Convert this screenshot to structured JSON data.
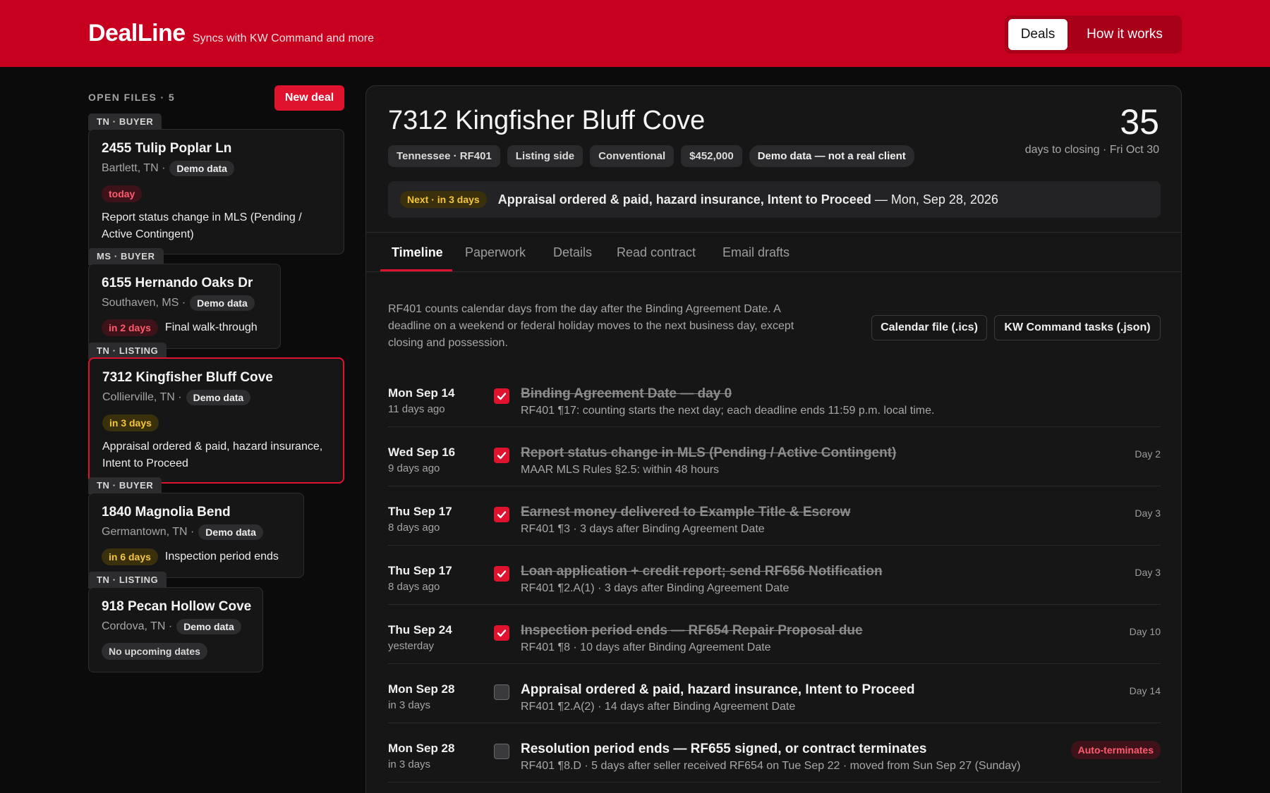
{
  "header": {
    "brand": "DealLine",
    "tagline": "Syncs with KW Command and more",
    "nav": {
      "deals": "Deals",
      "how": "How it works"
    },
    "brand_color": "#c8001f"
  },
  "sidebar": {
    "heading": "OPEN FILES · 5",
    "new_deal": "New deal",
    "cards": [
      {
        "tag": "TN · BUYER",
        "title": "2455 Tulip Poplar Ln",
        "loc": "Bartlett, TN ·",
        "demo": "Demo data",
        "pill": "today",
        "pill_color": "red",
        "task": "Report status change in MLS (Pending / Active Contingent)"
      },
      {
        "tag": "MS · BUYER",
        "title": "6155 Hernando Oaks Dr",
        "loc": "Southaven, MS ·",
        "demo": "Demo data",
        "pill": "in 2 days",
        "pill_color": "red",
        "task": "Final walk-through"
      },
      {
        "tag": "TN · LISTING",
        "title": "7312 Kingfisher Bluff Cove",
        "loc": "Collierville, TN ·",
        "demo": "Demo data",
        "pill": "in 3 days",
        "pill_color": "yellow",
        "task": "Appraisal ordered & paid, hazard insurance, Intent to Proceed"
      },
      {
        "tag": "TN · BUYER",
        "title": "1840 Magnolia Bend",
        "loc": "Germantown, TN ·",
        "demo": "Demo data",
        "pill": "in 6 days",
        "pill_color": "yellow",
        "task": "Inspection period ends"
      },
      {
        "tag": "TN · LISTING",
        "title": "918 Pecan Hollow Cove",
        "loc": "Cordova, TN ·",
        "demo": "Demo data",
        "pill": "No upcoming dates",
        "pill_color": "gray",
        "task": ""
      }
    ]
  },
  "deal": {
    "title": "7312 Kingfisher Bluff Cove",
    "chips": [
      "Tennessee · RF401",
      "Listing side",
      "Conventional",
      "$452,000",
      "Demo data — not a real client"
    ],
    "days_to_closing": "35",
    "days_sub": "days to closing · Fri Oct 30",
    "next": {
      "pill": "Next · in 3 days",
      "task": "Appraisal ordered & paid, hazard insurance, Intent to Proceed",
      "date": " — Mon, Sep 28, 2026"
    },
    "tabs": [
      "Timeline",
      "Paperwork",
      "Details",
      "Read contract",
      "Email drafts"
    ],
    "intro": "RF401 counts calendar days from the day after the Binding Agreement Date. A deadline on a weekend or federal holiday moves to the next business day, except closing and possession.",
    "exports": {
      "ics": "Calendar file (.ics)",
      "json": "KW Command tasks (.json)"
    },
    "timeline": [
      {
        "date": "Mon Sep 14",
        "rel": "11 days ago",
        "done": true,
        "title": "Binding Agreement Date — day 0",
        "sub": "RF401 ¶17: counting starts the next day; each deadline ends 11:59 p.m. local time.",
        "day": ""
      },
      {
        "date": "Wed Sep 16",
        "rel": "9 days ago",
        "done": true,
        "title": "Report status change in MLS (Pending / Active Contingent)",
        "sub": "MAAR MLS Rules §2.5: within 48 hours",
        "day": "Day 2"
      },
      {
        "date": "Thu Sep 17",
        "rel": "8 days ago",
        "done": true,
        "title": "Earnest money delivered to Example Title & Escrow",
        "sub": "RF401 ¶3 · 3 days after Binding Agreement Date",
        "day": "Day 3"
      },
      {
        "date": "Thu Sep 17",
        "rel": "8 days ago",
        "done": true,
        "title": "Loan application + credit report; send RF656 Notification",
        "sub": "RF401 ¶2.A(1) · 3 days after Binding Agreement Date",
        "day": "Day 3"
      },
      {
        "date": "Thu Sep 24",
        "rel": "yesterday",
        "done": true,
        "title": "Inspection period ends — RF654 Repair Proposal due",
        "sub": "RF401 ¶8 · 10 days after Binding Agreement Date",
        "day": "Day 10"
      },
      {
        "date": "Mon Sep 28",
        "rel": "in 3 days",
        "done": false,
        "title": "Appraisal ordered & paid, hazard insurance, Intent to Proceed",
        "sub": "RF401 ¶2.A(2) · 14 days after Binding Agreement Date",
        "day": "Day 14"
      },
      {
        "date": "Mon Sep 28",
        "rel": "in 3 days",
        "done": false,
        "title": "Resolution period ends — RF655 signed, or contract terminates",
        "sub": "RF401 ¶8.D · 5 days after seller received RF654 on Tue Sep 22 · moved from Sun Sep 27 (Sunday)",
        "day": "",
        "badge": "Auto-terminates"
      }
    ]
  }
}
